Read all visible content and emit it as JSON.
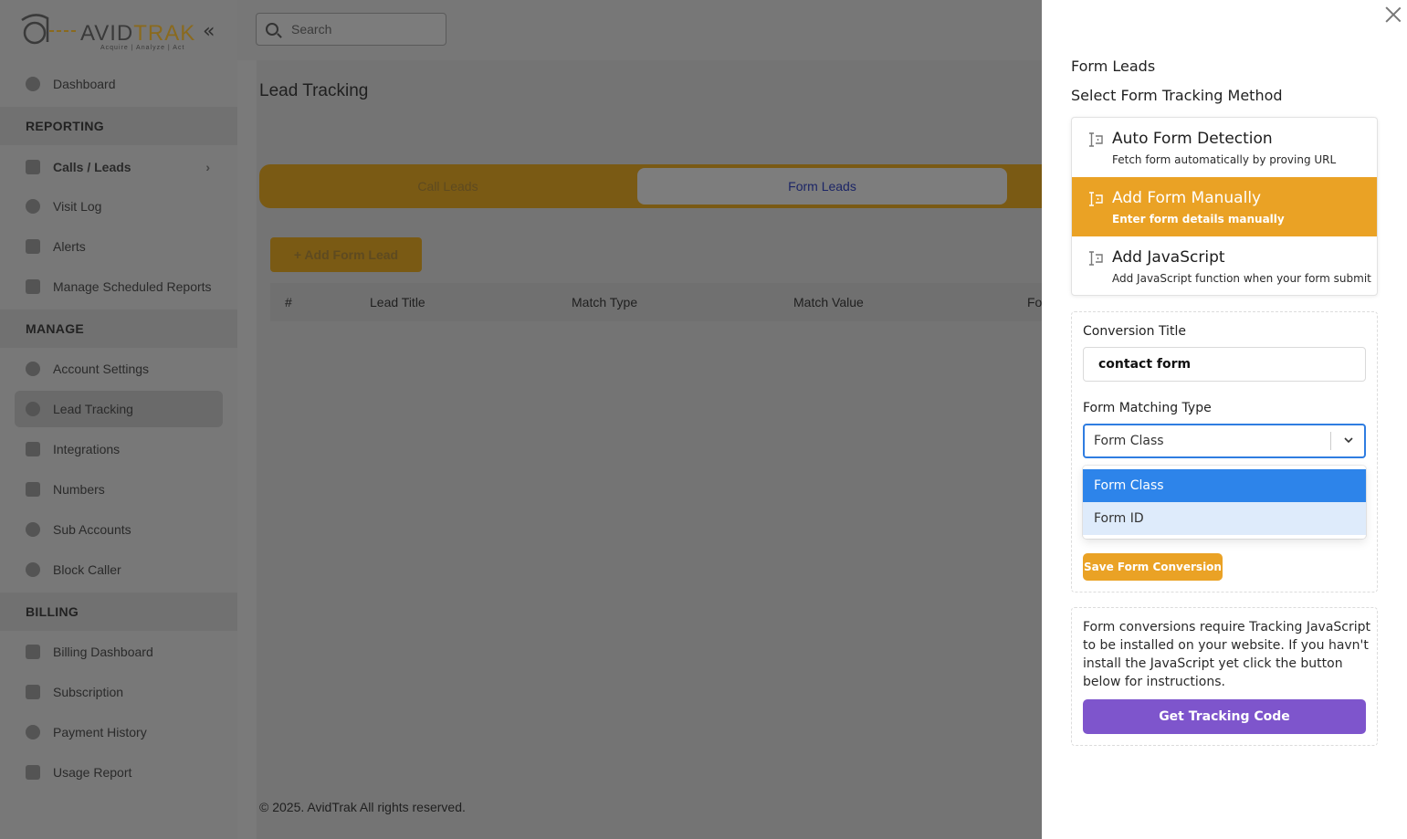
{
  "app": {
    "logo": {
      "name": "AVIDTRAK",
      "name_left": "AVID",
      "name_right": "TRAK",
      "tagline": "Acquire  |  Analyze  |  Act"
    },
    "collapse_icon": "double-chevron-left-icon",
    "search": {
      "placeholder": "Search"
    },
    "sidebar": {
      "dashboard": "Dashboard",
      "reporting_header": "REPORTING",
      "calls_leads": "Calls / Leads",
      "visit_log": "Visit Log",
      "alerts": "Alerts",
      "manage_scheduled_reports": "Manage Scheduled Reports",
      "manage_header": "MANAGE",
      "account_settings": "Account Settings",
      "lead_tracking": "Lead Tracking",
      "integrations": "Integrations",
      "numbers": "Numbers",
      "sub_accounts": "Sub Accounts",
      "block_caller": "Block Caller",
      "billing_header": "BILLING",
      "billing_dashboard": "Billing Dashboard",
      "subscription": "Subscription",
      "payment_history": "Payment History",
      "usage_report": "Usage Report"
    },
    "page_title": "Lead Tracking",
    "tabs": {
      "call_leads": "Call Leads",
      "form_leads": "Form Leads"
    },
    "add_form_lead": "+ Add Form Lead",
    "table_headers": [
      "#",
      "Lead Title",
      "Match Type",
      "Match Value",
      "Fo"
    ],
    "footer": "© 2025. AvidTrak All rights reserved."
  },
  "drawer": {
    "title": "Form Leads",
    "subtitle": "Select Form Tracking Method",
    "methods": [
      {
        "title": "Auto Form Detection",
        "description": "Fetch form automatically by proving URL",
        "selected": false
      },
      {
        "title": "Add Form Manually",
        "description": "Enter form details manually",
        "selected": true
      },
      {
        "title": "Add JavaScript",
        "description": "Add JavaScript function when your form submit",
        "selected": false
      }
    ],
    "conversion_title_label": "Conversion Title",
    "conversion_title_value": "contact form",
    "matching_type_label": "Form Matching Type",
    "matching_type_value": "Form Class",
    "matching_options": [
      "Form Class",
      "Form ID"
    ],
    "save_button": "Save Form Conversion",
    "info_text": "Form conversions require Tracking JavaScript to be installed on your website. If you havn't install the JavaScript yet click the button below for instructions.",
    "tracking_button": "Get Tracking Code",
    "colors": {
      "accent": "#eaa225",
      "select_blue": "#2d84ea",
      "purple": "#7e55cc"
    }
  }
}
